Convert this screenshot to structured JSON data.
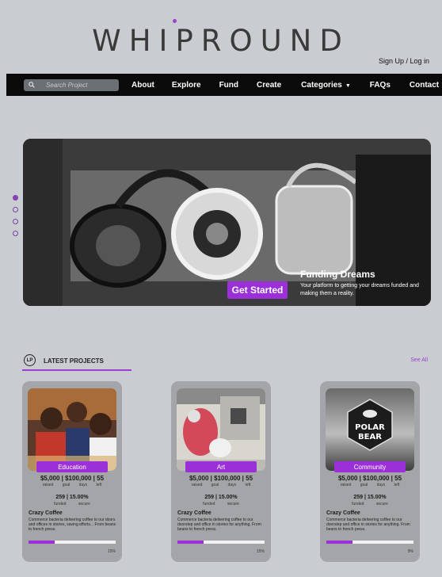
{
  "brand": {
    "name": "WHIPROUND"
  },
  "header": {
    "auth_label": "Sign Up / Log in"
  },
  "nav": {
    "search_placeholder": "Search Project",
    "items": [
      {
        "label": "About"
      },
      {
        "label": "Explore"
      },
      {
        "label": "Fund"
      },
      {
        "label": "Create"
      },
      {
        "label": "Categories"
      },
      {
        "label": "FAQs"
      },
      {
        "label": "Contact"
      }
    ],
    "categories_caret": "▼"
  },
  "hero": {
    "title": "Funding Dreams",
    "subtitle": "Your platform to getting your dreams funded and making them a reality.",
    "cta": "Get Started",
    "slide_count": 4,
    "active_slide": 1
  },
  "latest": {
    "badge": "LP",
    "title": "LATEST PROJECTS",
    "see_all": "See All"
  },
  "cards": [
    {
      "category": "Education",
      "stats_top": "$5,000  |  $100,000  |  55",
      "labels_top": "raised goal days left",
      "stats_bottom": "259  |  15.00%",
      "labels_bottom": "funded secure",
      "title": "Crazy Coffee",
      "description": "Commerce bacteria delivering coffee to our doors and offices in stories, saving efforts... From beans to french press.",
      "progress": 0.3,
      "progress_label": "15%"
    },
    {
      "category": "Art",
      "stats_top": "$5,000  |  $100,000  |  55",
      "labels_top": "raised goal days left",
      "stats_bottom": "259  |  15.00%",
      "labels_bottom": "funded secure",
      "title": "Crazy Coffee",
      "description": "Commerce bacteria delivering coffee to our doorstep and office in stories for anything. From beans to french press.",
      "progress": 0.3,
      "progress_label": "15%"
    },
    {
      "category": "Community",
      "stats_top": "$5,000  |  $100,000  |  55",
      "labels_top": "raised goal days left",
      "stats_bottom": "259  |  15.00%",
      "labels_bottom": "funded secure",
      "title": "Crazy Coffee",
      "description": "Commerce bacteria delivering coffee to our doorstep and office in stories for anything. From beans to french press.",
      "progress": 0.3,
      "progress_label": "9%"
    }
  ],
  "colors": {
    "accent": "#9b30d9",
    "nav_bg": "#0a0a0a",
    "page_bg": "#c9ccd1"
  },
  "icons": {
    "search": "search-icon",
    "education": "children-photo",
    "art": "art-photo",
    "community": "polar-bear-logo"
  }
}
